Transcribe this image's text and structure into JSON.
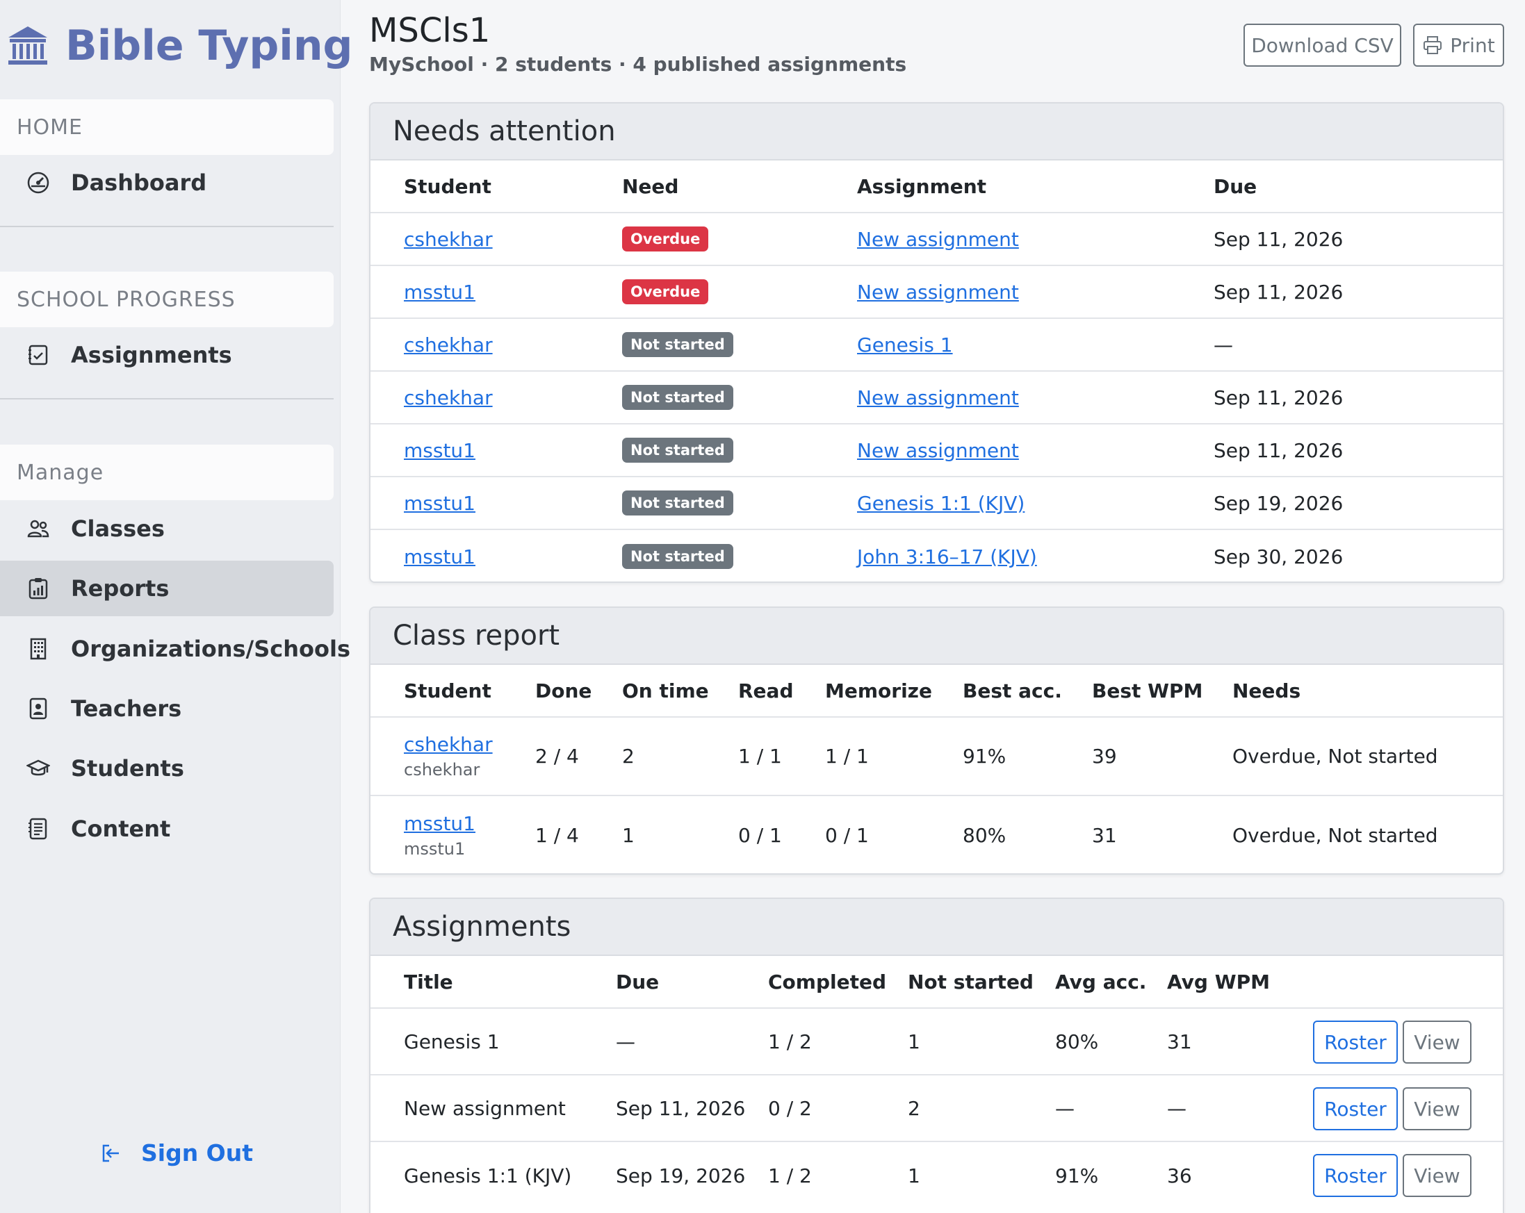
{
  "app": {
    "title": "Bible Typing"
  },
  "sidebar": {
    "sections": [
      {
        "header": "HOME",
        "items": [
          {
            "label": "Dashboard",
            "icon": "dashboard-icon"
          }
        ]
      },
      {
        "header": "SCHOOL PROGRESS",
        "items": [
          {
            "label": "Assignments",
            "icon": "assignments-icon"
          }
        ]
      },
      {
        "header": "Manage",
        "items": [
          {
            "label": "Classes",
            "icon": "people-icon"
          },
          {
            "label": "Reports",
            "icon": "reports-icon",
            "active": true
          },
          {
            "label": "Organizations/Schools",
            "icon": "building-icon"
          },
          {
            "label": "Teachers",
            "icon": "badge-icon"
          },
          {
            "label": "Students",
            "icon": "mortarboard-icon"
          },
          {
            "label": "Content",
            "icon": "document-icon"
          }
        ]
      }
    ],
    "sign_out": "Sign Out"
  },
  "header": {
    "title": "MSCls1",
    "subtitle": "MySchool · 2 students · 4 published assignments",
    "download_csv": "Download CSV",
    "print": "Print"
  },
  "needs_attention": {
    "title": "Needs attention",
    "columns": [
      "Student",
      "Need",
      "Assignment",
      "Due"
    ],
    "rows": [
      {
        "student": "cshekhar",
        "need": "Overdue",
        "need_type": "danger",
        "assignment": "New assignment",
        "due": "Sep 11, 2026"
      },
      {
        "student": "msstu1",
        "need": "Overdue",
        "need_type": "danger",
        "assignment": "New assignment",
        "due": "Sep 11, 2026"
      },
      {
        "student": "cshekhar",
        "need": "Not started",
        "need_type": "secondary",
        "assignment": "Genesis 1",
        "due": "—"
      },
      {
        "student": "cshekhar",
        "need": "Not started",
        "need_type": "secondary",
        "assignment": "New assignment",
        "due": "Sep 11, 2026"
      },
      {
        "student": "msstu1",
        "need": "Not started",
        "need_type": "secondary",
        "assignment": "New assignment",
        "due": "Sep 11, 2026"
      },
      {
        "student": "msstu1",
        "need": "Not started",
        "need_type": "secondary",
        "assignment": "Genesis 1:1 (KJV)",
        "due": "Sep 19, 2026"
      },
      {
        "student": "msstu1",
        "need": "Not started",
        "need_type": "secondary",
        "assignment": "John 3:16–17 (KJV)",
        "due": "Sep 30, 2026"
      }
    ]
  },
  "class_report": {
    "title": "Class report",
    "columns": [
      "Student",
      "Done",
      "On time",
      "Read",
      "Memorize",
      "Best acc.",
      "Best WPM",
      "Needs"
    ],
    "rows": [
      {
        "student": "cshekhar",
        "username": "cshekhar",
        "done": "2 / 4",
        "on_time": "2",
        "read": "1 / 1",
        "memorize": "1 / 1",
        "best_acc": "91%",
        "best_wpm": "39",
        "needs": "Overdue, Not started"
      },
      {
        "student": "msstu1",
        "username": "msstu1",
        "done": "1 / 4",
        "on_time": "1",
        "read": "0 / 1",
        "memorize": "0 / 1",
        "best_acc": "80%",
        "best_wpm": "31",
        "needs": "Overdue, Not started"
      }
    ]
  },
  "assignments": {
    "title": "Assignments",
    "columns": [
      "Title",
      "Due",
      "Completed",
      "Not started",
      "Avg acc.",
      "Avg WPM"
    ],
    "roster_label": "Roster",
    "view_label": "View",
    "rows": [
      {
        "title": "Genesis 1",
        "due": "—",
        "completed": "1 / 2",
        "not_started": "1",
        "avg_acc": "80%",
        "avg_wpm": "31"
      },
      {
        "title": "New assignment",
        "due": "Sep 11, 2026",
        "completed": "0 / 2",
        "not_started": "2",
        "avg_acc": "—",
        "avg_wpm": "—"
      },
      {
        "title": "Genesis 1:1 (KJV)",
        "due": "Sep 19, 2026",
        "completed": "1 / 2",
        "not_started": "1",
        "avg_acc": "91%",
        "avg_wpm": "36"
      }
    ]
  }
}
